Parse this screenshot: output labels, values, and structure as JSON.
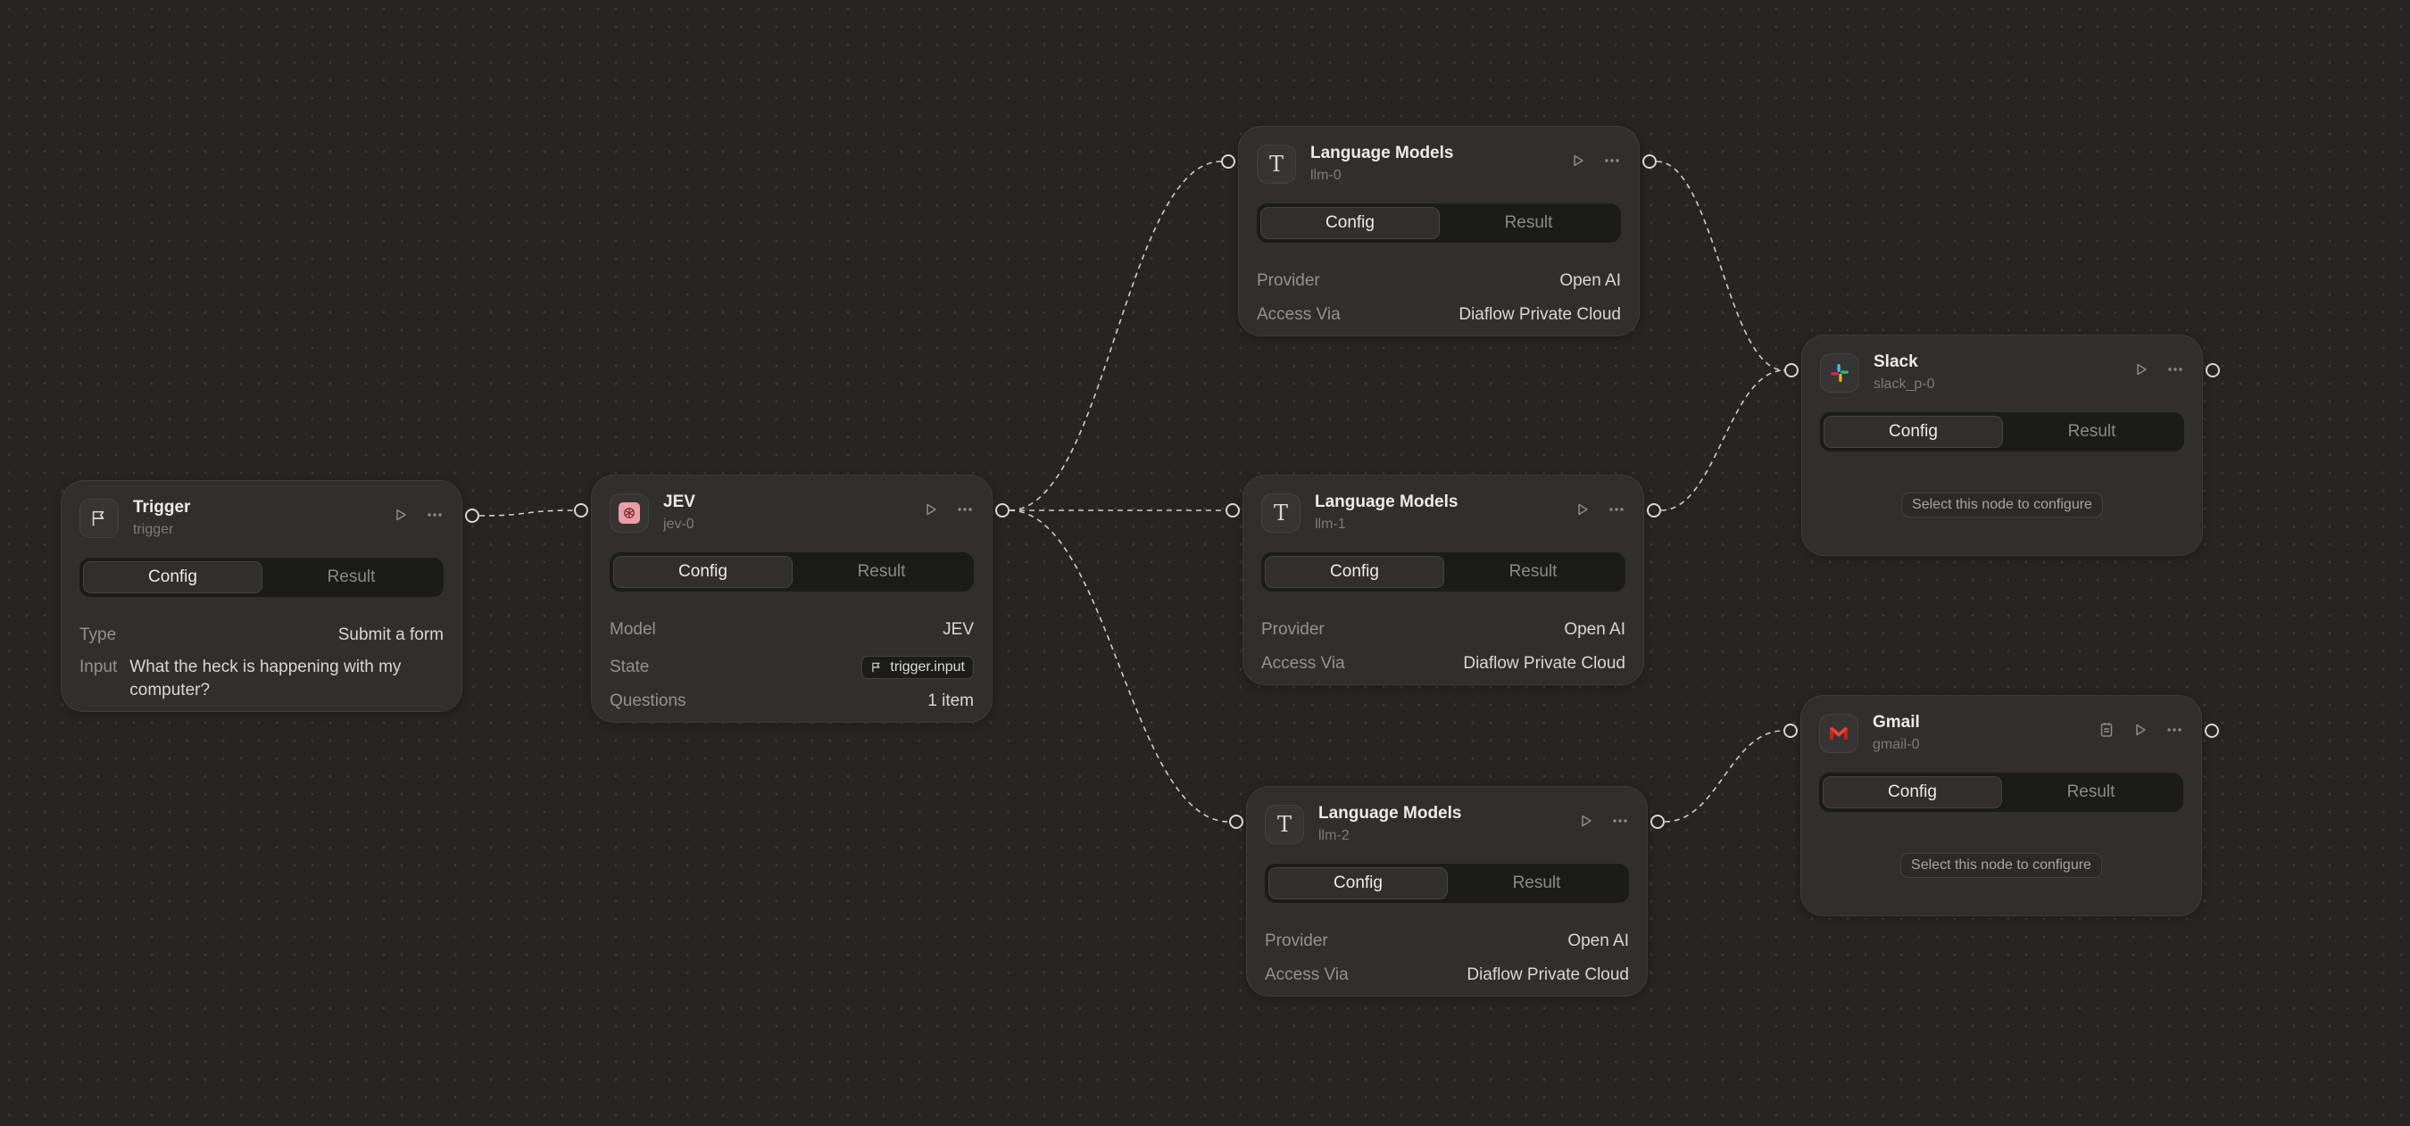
{
  "nodes": {
    "trigger": {
      "title": "Trigger",
      "id": "trigger",
      "icon": "flag-icon",
      "tabs": [
        "Config",
        "Result"
      ],
      "type_label": "Type",
      "type_value": "Submit a form",
      "input_label": "Input",
      "input_value": "What the heck is happening with my computer?"
    },
    "jev": {
      "title": "JEV",
      "id": "jev-0",
      "icon": "openai-logo-icon",
      "tabs": [
        "Config",
        "Result"
      ],
      "model_label": "Model",
      "model_value": "JEV",
      "state_label": "State",
      "state_value": "trigger.input",
      "questions_label": "Questions",
      "questions_value": "1 item"
    },
    "llm0": {
      "title": "Language Models",
      "id": "llm-0",
      "icon": "text-t-icon",
      "tabs": [
        "Config",
        "Result"
      ],
      "provider_label": "Provider",
      "provider_value": "Open AI",
      "access_label": "Access Via",
      "access_value": "Diaflow Private Cloud"
    },
    "llm1": {
      "title": "Language Models",
      "id": "llm-1",
      "icon": "text-t-icon",
      "tabs": [
        "Config",
        "Result"
      ],
      "provider_label": "Provider",
      "provider_value": "Open AI",
      "access_label": "Access Via",
      "access_value": "Diaflow Private Cloud"
    },
    "llm2": {
      "title": "Language Models",
      "id": "llm-2",
      "icon": "text-t-icon",
      "tabs": [
        "Config",
        "Result"
      ],
      "provider_label": "Provider",
      "provider_value": "Open AI",
      "access_label": "Access Via",
      "access_value": "Diaflow Private Cloud"
    },
    "slack": {
      "title": "Slack",
      "id": "slack_p-0",
      "icon": "slack-logo-icon",
      "tabs": [
        "Config",
        "Result"
      ],
      "hint": "Select this node to configure"
    },
    "gmail": {
      "title": "Gmail",
      "id": "gmail-0",
      "icon": "gmail-logo-icon",
      "tabs": [
        "Config",
        "Result"
      ],
      "hint": "Select this node to configure"
    }
  },
  "edges": [
    [
      "trigger",
      "jev"
    ],
    [
      "jev",
      "llm0"
    ],
    [
      "jev",
      "llm1"
    ],
    [
      "jev",
      "llm2"
    ],
    [
      "llm0",
      "slack"
    ],
    [
      "llm1",
      "slack"
    ],
    [
      "llm2",
      "gmail"
    ]
  ],
  "colors": {
    "canvas": "#262524",
    "node": "#302f2d",
    "edge": "#cfcdc9",
    "gmail_red": "#ea4335"
  }
}
